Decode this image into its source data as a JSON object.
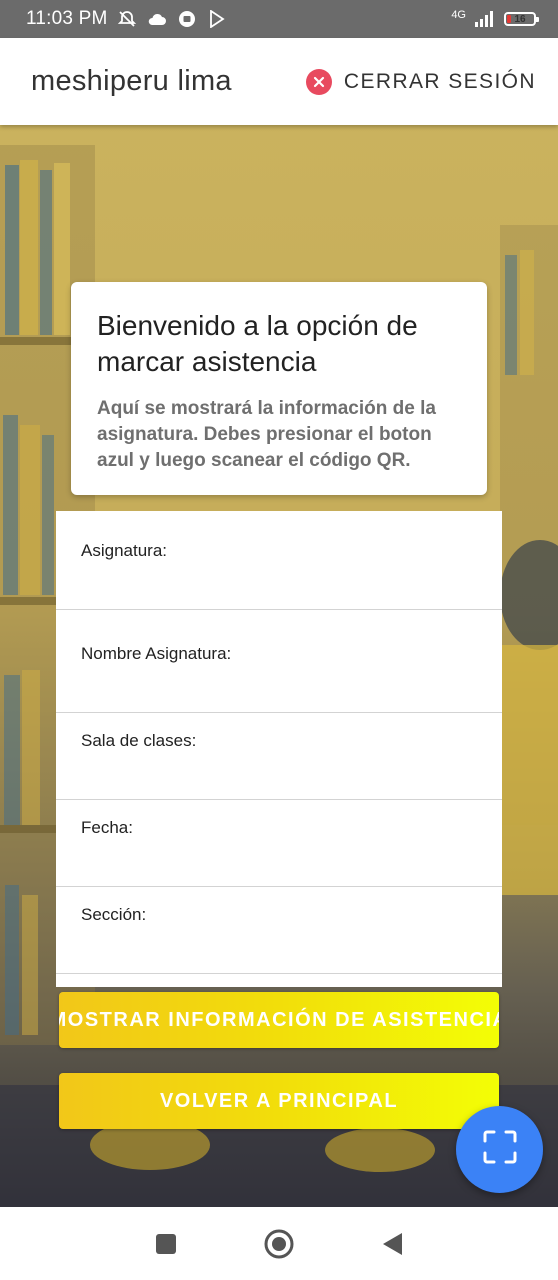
{
  "status_bar": {
    "time": "11:03 PM",
    "network": "4G",
    "battery": "16",
    "battery_level": 0.16,
    "icons": [
      "muted-bell-icon",
      "cloud-icon",
      "media-icon",
      "play-store-icon",
      "signal-icon",
      "battery-icon"
    ]
  },
  "app_bar": {
    "title": "meshiperu lima",
    "logout_label": "CERRAR SESIÓN",
    "logout_icon": "close-circle-icon",
    "logout_color": "#e84a5f"
  },
  "welcome": {
    "title": "Bienvenido a la opción de marcar asistencia",
    "subtitle": "Aquí se mostrará la información de la asignatura. Debes presionar el boton azul y luego scanear el código QR."
  },
  "info_fields": [
    {
      "label": "Asignatura:",
      "value": ""
    },
    {
      "label": "Nombre Asignatura:",
      "value": ""
    },
    {
      "label": "Sala de clases:",
      "value": ""
    },
    {
      "label": "Fecha:",
      "value": ""
    },
    {
      "label": "Sección:",
      "value": ""
    }
  ],
  "buttons": {
    "show_info": "MOSTRAR INFORMACIÓN DE ASISTENCIA",
    "back": "VOLVER A PRINCIPAL"
  },
  "fab": {
    "icon": "qr-scan-icon",
    "color": "#3b82f6"
  },
  "colors": {
    "button_gradient_start": "#f2c719",
    "button_gradient_end": "#f3fe05"
  },
  "nav_bar": {
    "icons": [
      "recents-square-icon",
      "home-circle-icon",
      "back-triangle-icon"
    ]
  }
}
